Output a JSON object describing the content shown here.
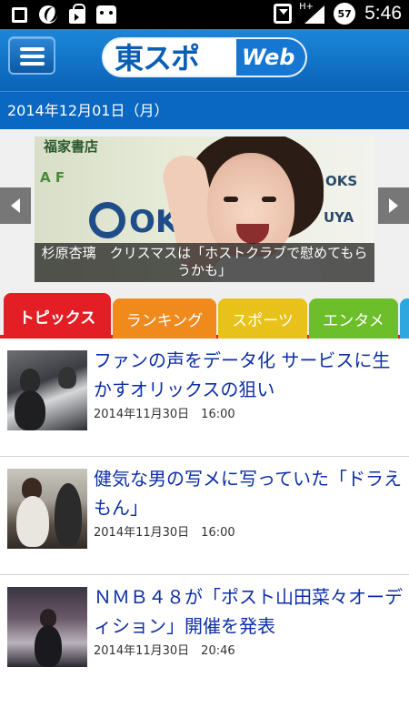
{
  "status_bar": {
    "time": "5:46",
    "battery_level": "57",
    "network_type": "H+",
    "icons": [
      "notification-square-icon",
      "sync-circle-icon",
      "shopping-bag-icon",
      "android-bot-icon",
      "battery-saver-icon",
      "signal-icon",
      "battery-icon"
    ]
  },
  "header": {
    "logo_text": "東スポ",
    "logo_suffix": "Web",
    "menu_icon": "hamburger-menu-icon"
  },
  "date_bar": {
    "date": "2014年12月01日（月）"
  },
  "carousel": {
    "caption": "杉原杏璃　クリスマスは「ホストクラブで慰めてもらうかも」",
    "prev_icon": "chevron-left-icon",
    "next_icon": "chevron-right-icon"
  },
  "tabs": [
    {
      "label": "トピックス",
      "color": "#e31e24",
      "active": true
    },
    {
      "label": "ランキング",
      "color": "#f08a1c",
      "active": false
    },
    {
      "label": "スポーツ",
      "color": "#e8c21a",
      "active": false
    },
    {
      "label": "エンタメ",
      "color": "#6cbf2a",
      "active": false
    },
    {
      "label": "",
      "color": "#2ea7e0",
      "active": false
    }
  ],
  "news": [
    {
      "headline": "ファンの声をデータ化 サービスに生かすオリックスの狙い",
      "time": "2014年11月30日　16:00"
    },
    {
      "headline": "健気な男の写メに写っていた「ドラえもん」",
      "time": "2014年11月30日　16:00"
    },
    {
      "headline": "ＮＭＢ４８が「ポスト山田菜々オーディション」開催を発表",
      "time": "2014年11月30日　20:46"
    }
  ]
}
